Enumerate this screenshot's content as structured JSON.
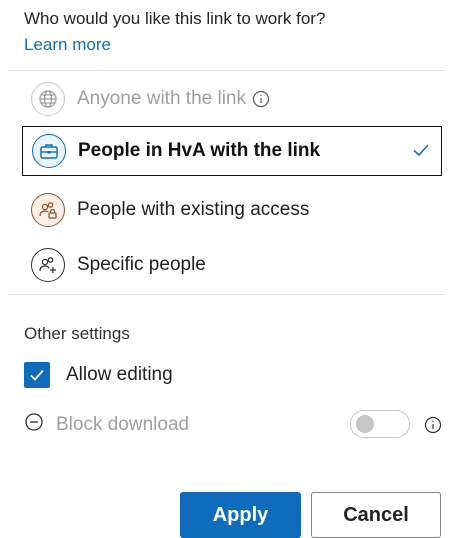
{
  "header": {
    "question": "Who would you like this link to work for?",
    "learn_more": "Learn more"
  },
  "options": [
    {
      "label": "Anyone with the link",
      "icon": "globe-icon",
      "state": "disabled"
    },
    {
      "label": "People in HvA with the link",
      "icon": "briefcase-icon",
      "state": "selected"
    },
    {
      "label": "People with existing access",
      "icon": "people-lock-icon",
      "state": "normal"
    },
    {
      "label": "Specific people",
      "icon": "people-add-icon",
      "state": "normal"
    }
  ],
  "settings": {
    "heading": "Other settings",
    "allow_editing": {
      "label": "Allow editing",
      "checked": true
    },
    "block_download": {
      "label": "Block download",
      "enabled": false,
      "toggle_on": false
    }
  },
  "buttons": {
    "apply": "Apply",
    "cancel": "Cancel"
  },
  "colors": {
    "accent": "#0f6cbd",
    "disabled_text": "#a19f9d",
    "existing_access_icon": "#8e562e"
  }
}
